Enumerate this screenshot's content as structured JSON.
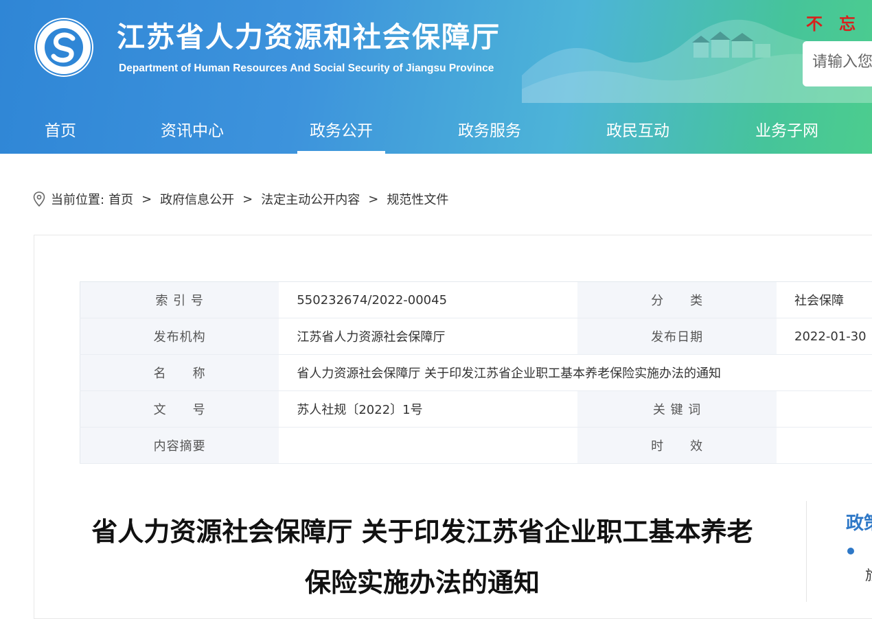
{
  "header": {
    "site_title": "江苏省人力资源和社会保障厅",
    "site_subtitle": "Department of Human Resources And Social Security of Jiangsu Province",
    "logo_text": "江苏省人力资源和社会保障厅",
    "slogan": "不忘",
    "search_placeholder": "请输入您"
  },
  "nav": {
    "items": [
      {
        "label": "首页"
      },
      {
        "label": "资讯中心"
      },
      {
        "label": "政务公开"
      },
      {
        "label": "政务服务"
      },
      {
        "label": "政民互动"
      },
      {
        "label": "业务子网"
      }
    ],
    "active": "政务公开"
  },
  "breadcrumb": {
    "prefix": "当前位置:",
    "items": [
      "首页",
      "政府信息公开",
      "法定主动公开内容",
      "规范性文件"
    ],
    "separator": ">"
  },
  "meta": {
    "index_label": "索 引 号",
    "index_value": "550232674/2022-00045",
    "category_label": "分　　类",
    "category_value": "社会保障",
    "issuer_label": "发布机构",
    "issuer_value": "江苏省人力资源社会保障厅",
    "date_label": "发布日期",
    "date_value": "2022-01-30",
    "name_label": "名　　称",
    "name_value": "省人力资源社会保障厅 关于印发江苏省企业职工基本养老保险实施办法的通知",
    "docno_label": "文　　号",
    "docno_value": "苏人社规〔2022〕1号",
    "keywords_label": "关 键 词",
    "keywords_value": "",
    "summary_label": "内容摘要",
    "summary_value": "",
    "validity_label": "时　　效",
    "validity_value": ""
  },
  "document": {
    "title": "省人力资源社会保障厅 关于印发江苏省企业职工基本养老保险实施办法的通知"
  },
  "sidebar": {
    "title": "政策",
    "item_text": "旅"
  },
  "colors": {
    "header_start": "#2f86d6",
    "header_end": "#4ccd8e",
    "slogan": "#d9201c",
    "accent": "#2e78c7",
    "label_bg": "#f4f6fa"
  }
}
